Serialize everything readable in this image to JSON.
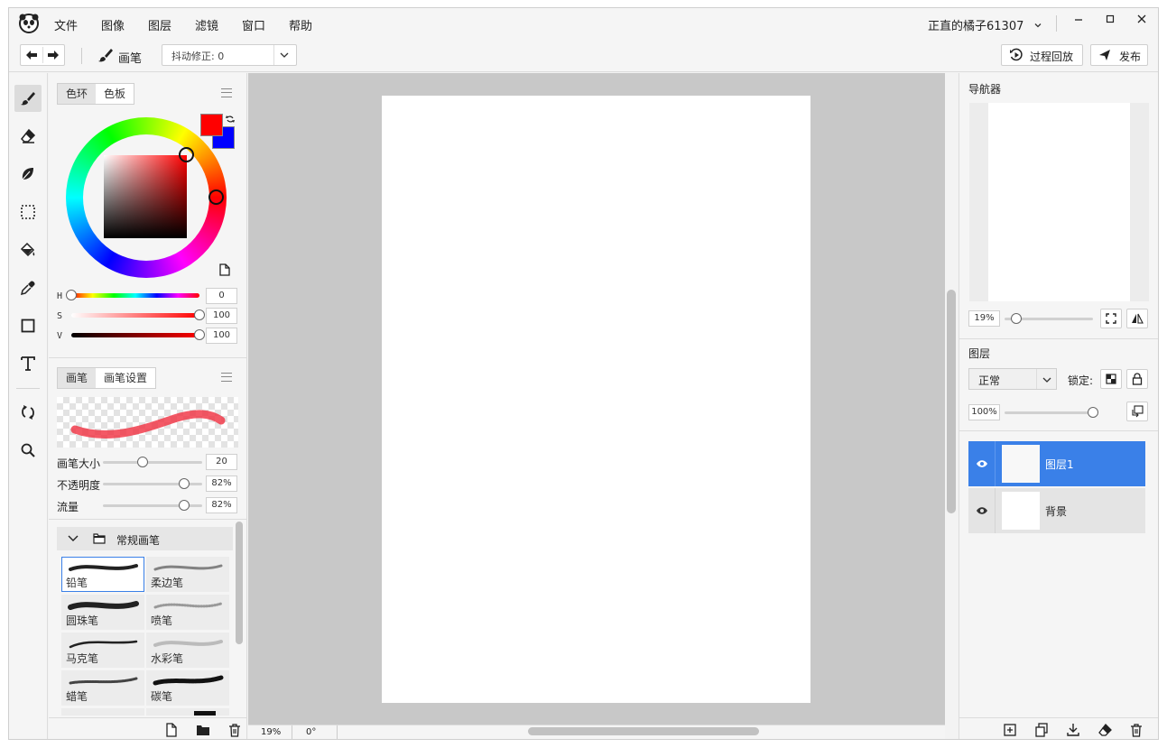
{
  "menu": [
    "文件",
    "图像",
    "图层",
    "滤镜",
    "窗口",
    "帮助"
  ],
  "user": {
    "name": "正直的橘子61307"
  },
  "toolbar": {
    "brush_label": "画笔",
    "stabilizer": "抖动修正: 0",
    "replay": "过程回放",
    "publish": "发布"
  },
  "color_panel": {
    "tabs": [
      "色环",
      "色板"
    ],
    "primary_color": "#ff0000",
    "secondary_color": "#0000ff",
    "sliders": [
      {
        "label": "H",
        "value": "0",
        "level": 0
      },
      {
        "label": "S",
        "value": "100",
        "level": 100
      },
      {
        "label": "V",
        "value": "100",
        "level": 100
      }
    ]
  },
  "brush_panel": {
    "tabs": [
      "画笔",
      "画笔设置"
    ],
    "settings": [
      {
        "label": "画笔大小",
        "value": "20",
        "level": 20
      },
      {
        "label": "不透明度",
        "value": "82%",
        "level": 82
      },
      {
        "label": "流量",
        "value": "82%",
        "level": 82
      }
    ],
    "group_name": "常规画笔",
    "brushes": [
      "铅笔",
      "柔边笔",
      "圆珠笔",
      "喷笔",
      "马克笔",
      "水彩笔",
      "蜡笔",
      "碳笔"
    ]
  },
  "status": {
    "zoom": "19%",
    "rotation": "0°"
  },
  "navigator": {
    "title": "导航器",
    "zoom": "19%",
    "zoom_level": 19
  },
  "layers_panel": {
    "title": "图层",
    "blend_mode": "正常",
    "lock_label": "锁定:",
    "opacity": "100%",
    "opacity_level": 100,
    "layers": [
      {
        "name": "图层1",
        "selected": true
      },
      {
        "name": "背景",
        "selected": false
      }
    ]
  },
  "colors": {
    "accent": "#3a80e8",
    "canvas_bg": "#c8c8c8",
    "paper": "#ffffff"
  }
}
